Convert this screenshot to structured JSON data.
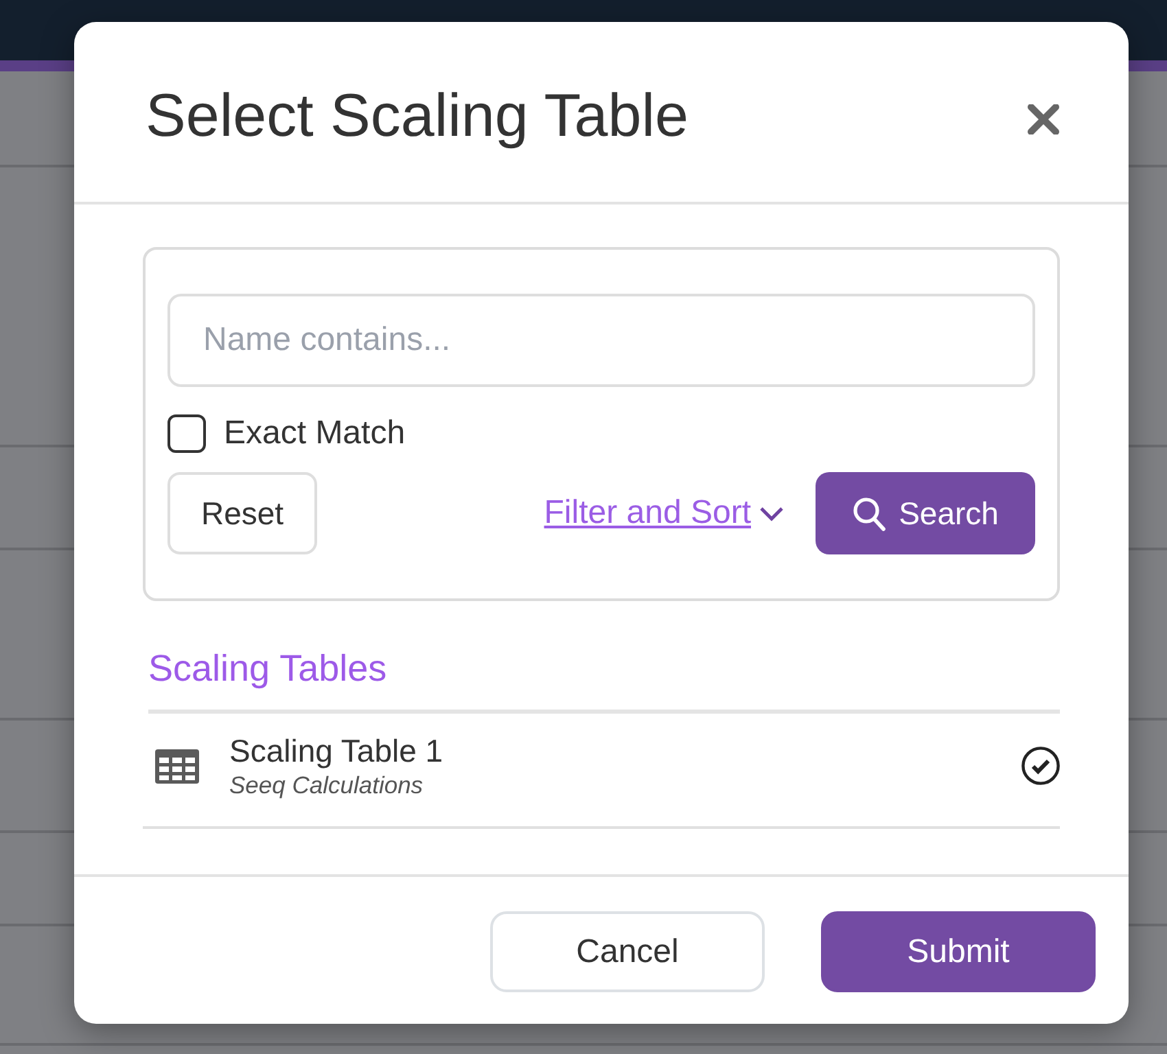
{
  "modal": {
    "title": "Select Scaling Table"
  },
  "search": {
    "placeholder": "Name contains...",
    "exact_match": {
      "label": "Exact Match",
      "checked": false
    },
    "reset_label": "Reset",
    "filter_link": "Filter and Sort",
    "search_label": "Search"
  },
  "results": {
    "heading": "Scaling Tables",
    "items": [
      {
        "name": "Scaling Table 1",
        "source": "Seeq Calculations",
        "selected": true
      }
    ]
  },
  "footer": {
    "buttons": [
      {
        "label": "Cancel",
        "kind": "secondary"
      },
      {
        "label": "Submit",
        "kind": "primary"
      }
    ]
  }
}
